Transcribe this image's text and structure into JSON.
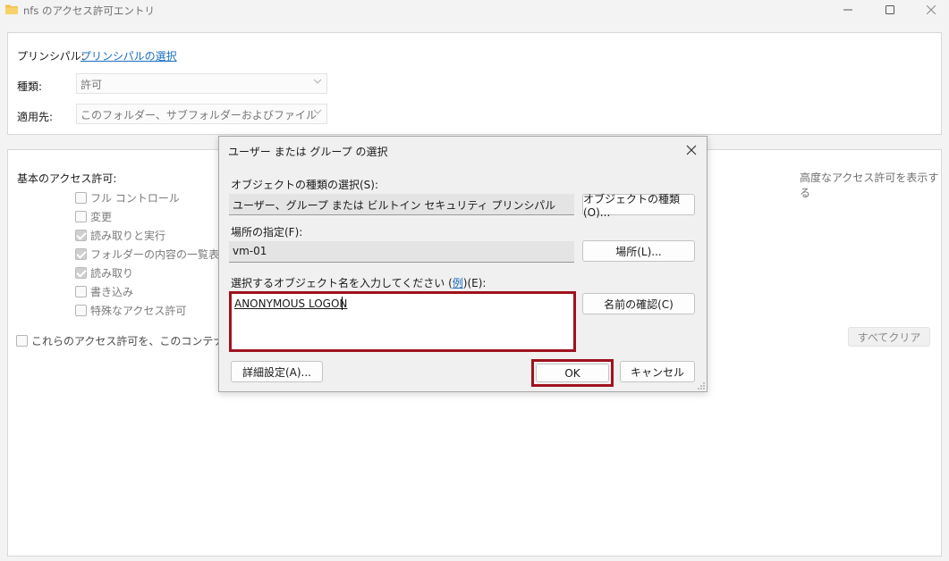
{
  "window": {
    "title": "nfs のアクセス許可エントリ"
  },
  "principal": {
    "label": "プリンシパル:",
    "link": "プリンシパルの選択"
  },
  "type": {
    "label": "種類:",
    "value": "許可"
  },
  "applies_to": {
    "label": "適用先:",
    "value": "このフォルダー、サブフォルダーおよびファイル"
  },
  "basic_permissions": {
    "heading": "基本のアクセス許可:",
    "show_advanced_link": "高度なアクセス許可を表示する",
    "items": [
      {
        "label": "フル コントロール",
        "checked": false
      },
      {
        "label": "変更",
        "checked": false
      },
      {
        "label": "読み取りと実行",
        "checked": true
      },
      {
        "label": "フォルダーの内容の一覧表示",
        "checked": true
      },
      {
        "label": "読み取り",
        "checked": true
      },
      {
        "label": "書き込み",
        "checked": false
      },
      {
        "label": "特殊なアクセス許可",
        "checked": false
      }
    ],
    "apply_container_label": "これらのアクセス許可を、このコンテナーの中",
    "clear_all_button": "すべてクリア"
  },
  "dialog": {
    "title": "ユーザー または グループ の選択",
    "object_type_label": "オブジェクトの種類の選択(S):",
    "object_type_value": "ユーザー、グループ または ビルトイン セキュリティ プリンシパル",
    "object_type_button": "オブジェクトの種類(O)...",
    "location_label": "場所の指定(F):",
    "location_value": "vm-01",
    "location_button": "場所(L)...",
    "enter_names_label_pre": "選択するオブジェクト名を入力してください (",
    "enter_names_example_link": "例",
    "enter_names_label_post": ")(E):",
    "names_value": "ANONYMOUS LOGON",
    "check_names_button": "名前の確認(C)",
    "advanced_button": "詳細設定(A)...",
    "ok_button": "OK",
    "cancel_button": "キャンセル"
  },
  "colors": {
    "highlight": "#a0121e",
    "link": "#1a6fc0"
  }
}
